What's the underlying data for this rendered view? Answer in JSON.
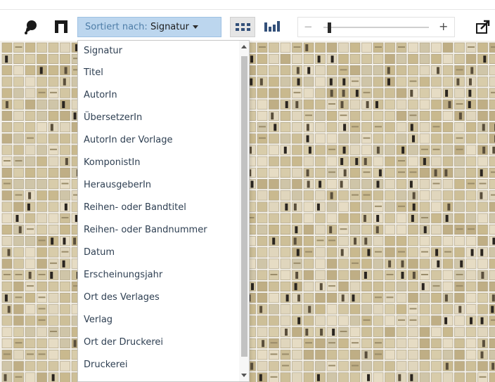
{
  "toolbar": {
    "lasso_icon": "lasso-select-icon",
    "crop_icon": "crop-selection-icon",
    "sort": {
      "prefix": "Sortiert nach:",
      "value": "Signatur"
    },
    "view_grid_icon": "grid-view-icon",
    "view_bars_icon": "bar-chart-view-icon",
    "zoom": {
      "minus": "−",
      "plus": "+",
      "level": 0.05
    },
    "export_icon": "export-icon"
  },
  "sort_dropdown": {
    "options": [
      "Signatur",
      "Titel",
      "AutorIn",
      "ÜbersetzerIn",
      "AutorIn der Vorlage",
      "KomponistIn",
      "HerausgeberIn",
      "Reihen- oder Bandtitel",
      "Reihen- oder Bandnummer",
      "Datum",
      "Erscheinungsjahr",
      "Ort des Verlages",
      "Verlag",
      "Ort der Druckerei",
      "Druckerei"
    ]
  },
  "colors": {
    "accent": "#bcd6ee",
    "dropdown_text": "#2e3f52",
    "thumb_palette": [
      "#d8ccaa",
      "#cdbf98",
      "#e0d6bd",
      "#c9b98e",
      "#d3c6a2",
      "#bfae85",
      "#e6dcc4",
      "#cfc5a8"
    ]
  }
}
